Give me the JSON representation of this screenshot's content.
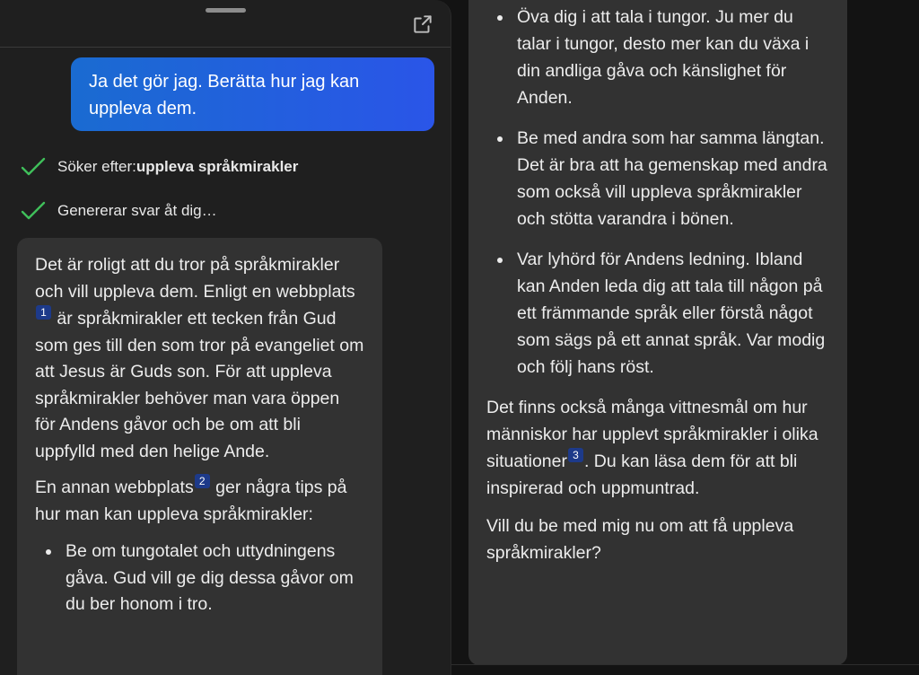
{
  "chat": {
    "user_message": "Ja det gör jag. Berätta hur jag kan uppleva dem.",
    "status": [
      {
        "prefix": "Söker efter: ",
        "bold": "uppleva språkmirakler"
      },
      {
        "prefix": "Genererar svar åt dig…",
        "bold": ""
      }
    ]
  },
  "answer_left": {
    "p1_a": "Det är roligt att du tror på språkmirakler och vill uppleva dem. Enligt en webbplats",
    "cite1": "1",
    "p1_b": " är språkmirakler ett tecken från Gud som ges till den som tror på evangeliet om att Jesus är Guds son. För att uppleva språkmirakler behöver man vara öppen för Andens gåvor och be om att bli uppfylld med den helige Ande.",
    "p2_a": "En annan webbplats",
    "cite2": "2",
    "p2_b": " ger några tips på hur man kan uppleva språkmirakler:",
    "bullets": [
      "Be om tungotalet och uttydningens gåva. Gud vill ge dig dessa gåvor om du ber honom i tro."
    ]
  },
  "answer_right": {
    "bullets": [
      "Öva dig i att tala i tungor. Ju mer du talar i tungor, desto mer kan du växa i din andliga gåva och känslighet för Anden.",
      "Be med andra som har samma längtan. Det är bra att ha gemenskap med andra som också vill uppleva språkmirakler och stötta varandra i bönen.",
      "Var lyhörd för Andens ledning. Ibland kan Anden leda dig att tala till någon på ett främmande språk eller förstå något som sägs på ett annat språk. Var modig och följ hans röst."
    ],
    "p3_a": "Det finns också många vittnesmål om hur människor har upplevt språkmirakler i olika situationer",
    "cite3": "3",
    "p3_b": ". Du kan läsa dem för att bli inspirerad och uppmuntrad.",
    "p4": "Vill du be med mig nu om att få uppleva språkmirakler?"
  },
  "colors": {
    "user_bubble": "#2a55e8",
    "check": "#3fbf5a",
    "card": "#323232",
    "citation": "#1d3a8a"
  },
  "icons": {
    "share": "share-icon",
    "check": "check-icon",
    "handle": "drag-handle"
  }
}
